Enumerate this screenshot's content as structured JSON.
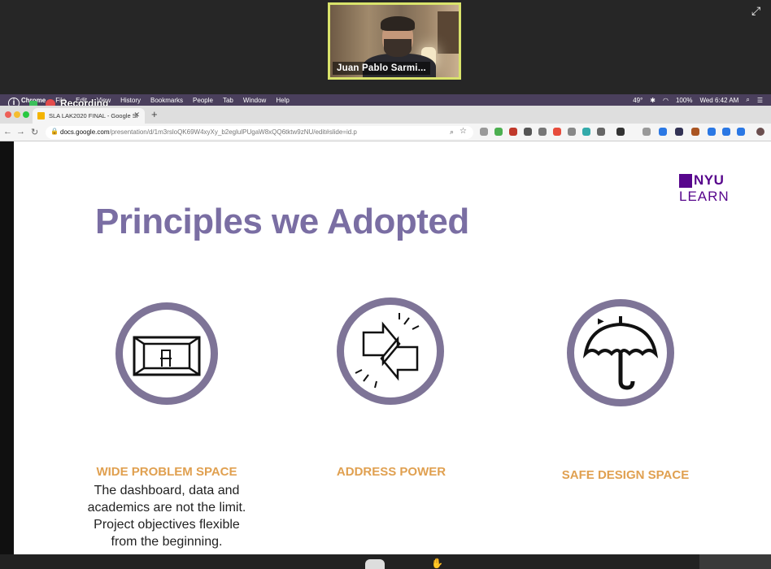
{
  "video": {
    "participant_name": "Juan Pablo Sarmi..."
  },
  "mac_menu": {
    "app": "Chrome",
    "items": [
      "File",
      "Edit",
      "View",
      "History",
      "Bookmarks",
      "People",
      "Tab",
      "Window",
      "Help"
    ],
    "status": {
      "battery": "100%",
      "clock": "Wed 6:42 AM",
      "temp": "49°"
    }
  },
  "recording": {
    "label": "Recording"
  },
  "browser": {
    "tab_title": "SLA LAK2020 FINAL - Google Sl",
    "url_host": "docs.google.com",
    "url_path": "/presentation/d/1m3rsloQK69W4xyXy_b2eglulPUgaW8xQQ6tktw9zNU/edit#slide=id.p"
  },
  "slide": {
    "logo_top": "NYU",
    "logo_bottom": "LEARN",
    "title": "Principles we Adopted",
    "principles": [
      {
        "heading": "WIDE PROBLEM SPACE",
        "body": [
          "The dashboard, data and",
          "academics are not the limit.",
          "Project objectives flexible",
          "from the beginning."
        ],
        "icon": "empty-room-icon"
      },
      {
        "heading": "ADDRESS POWER",
        "body": [],
        "icon": "opposing-arrows-icon"
      },
      {
        "heading": "SAFE DESIGN SPACE",
        "body": [],
        "icon": "umbrella-icon"
      }
    ]
  },
  "colors": {
    "accent_purple": "#7a6ea3",
    "accent_orange": "#e0a050",
    "nyu_purple": "#57068c"
  }
}
